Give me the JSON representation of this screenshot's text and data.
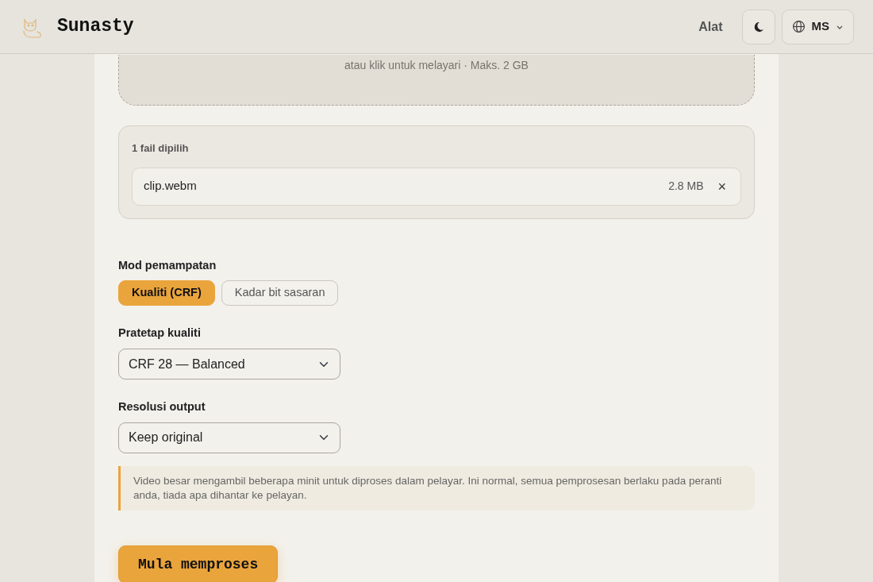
{
  "header": {
    "brand": "Sunasty",
    "nav_link": "Alat",
    "language": "MS"
  },
  "drop_zone": {
    "hint": "atau klik untuk melayari · Maks. 2 GB"
  },
  "files": {
    "heading": "1 fail dipilih",
    "items": [
      {
        "name": "clip.webm",
        "size": "2.8 MB",
        "remove": "×"
      }
    ]
  },
  "compression_mode": {
    "label": "Mod pemampatan",
    "options": [
      {
        "label": "Kualiti (CRF)",
        "selected": true
      },
      {
        "label": "Kadar bit sasaran",
        "selected": false
      }
    ]
  },
  "quality_preset": {
    "label": "Pratetap kualiti",
    "value": "CRF 28 — Balanced"
  },
  "output_resolution": {
    "label": "Resolusi output",
    "value": "Keep original"
  },
  "notice": "Video besar mengambil beberapa minit untuk diproses dalam pelayar. Ini normal, semua pemprosesan berlaku pada peranti anda, tiada apa dihantar ke pelayan.",
  "start_button": "Mula memproses"
}
